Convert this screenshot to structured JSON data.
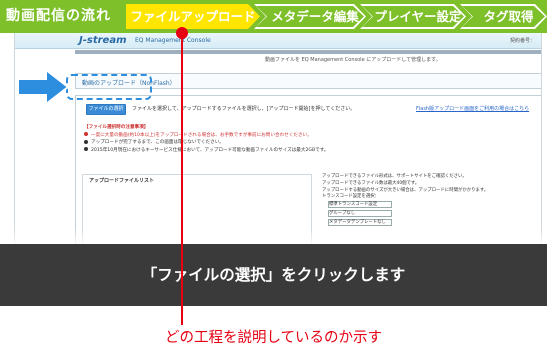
{
  "stepbar": {
    "flow_title": "動画配信の流れ",
    "steps": [
      {
        "label": "ファイルアップロード",
        "active": true
      },
      {
        "label": "メタデータ編集",
        "active": false
      },
      {
        "label": "プレイヤー設定",
        "active": false
      },
      {
        "label": "タグ取得",
        "active": false
      }
    ]
  },
  "app": {
    "logo": "J-stream",
    "logo_sub": "EQ Management Console",
    "header_right": "契約番号：",
    "breadcrumb": "動画ファイルを EQ Management Console にアップロードして管理します。",
    "page_title": "動画のアップロード（NonFlash）",
    "file_button": "ファイルの選択",
    "description": "ファイルを選択して、アップロードするファイルを選択し、[アップロード開始]を押してください。",
    "help_link": "Flash版アップロード画面をご利用の場合はこちら",
    "notes_head": "【ファイル選択時の注意事項】",
    "notes": [
      {
        "bullet": "red",
        "text": "一度に大量の動画(約10本以上)をアップロードされる場合は、お手数ですが事前にお問い合わせください。"
      },
      {
        "bullet": "black",
        "text": "アップロードが完了するまで、この画面は閉じないでください。"
      },
      {
        "bullet": "black",
        "text": "2015年10月現在におけるキーサービス仕様において、アップロード可能な動画ファイルのサイズは最大2GBです。"
      }
    ],
    "list_title": "アップロードファイルリスト",
    "side_lines": [
      "アップロードできるファイル形式は、サポートサイトをご確認ください。",
      "アップロードできるファイル数は最大40個です。",
      "アップロードする動画のサイズが大きい場合は、アップロードに時間がかかります。",
      "トランスコード設定を選択："
    ],
    "side_fields": [
      "標準トランスコード設定",
      "グループなし",
      "メタデータテンプレートなし"
    ]
  },
  "caption": "「ファイルの選択」をクリックします",
  "annotation": "どの工程を説明しているのか示す",
  "colors": {
    "green": "#7ec02a",
    "yellow": "#ffe600",
    "red": "#e60012",
    "blue": "#2d8ee0",
    "band": "#3a3a3a"
  }
}
